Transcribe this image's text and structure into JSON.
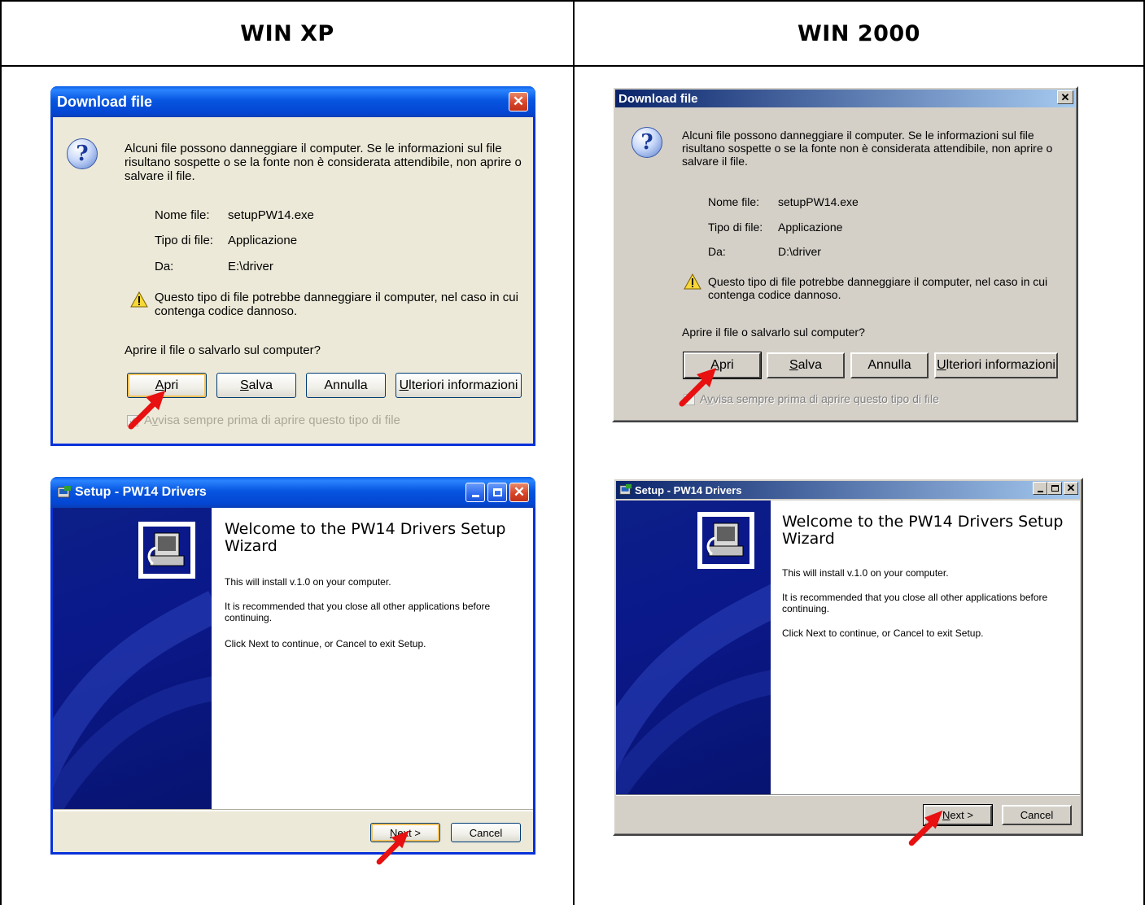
{
  "columns": {
    "left": "WIN XP",
    "right": "WIN 2000"
  },
  "download": {
    "title": "Download file",
    "message": "Alcuni file possono danneggiare il computer. Se le informazioni sul file risultano sospette o se la fonte non è considerata attendibile, non aprire o salvare il file.",
    "name_label": "Nome file:",
    "name_value": "setupPW14.exe",
    "type_label": "Tipo di file:",
    "type_value": "Applicazione",
    "from_label": "Da:",
    "from_value_xp": "E:\\driver",
    "from_value_2k": "D:\\driver",
    "warning": "Questo tipo di file potrebbe danneggiare il computer, nel caso in cui contenga codice dannoso.",
    "question": "Aprire il file o salvarlo sul computer?",
    "btn_open_pre": "A",
    "btn_open_rest": "pri",
    "btn_save_pre": "S",
    "btn_save_rest": "alva",
    "btn_cancel": "Annulla",
    "btn_more_pre": "U",
    "btn_more_rest": "lteriori informazioni",
    "checkbox_pre": "A",
    "checkbox_u": "v",
    "checkbox_rest": "visa sempre prima di aprire questo tipo di file",
    "checkbox_checked": true
  },
  "wizard": {
    "title": "Setup - PW14 Drivers",
    "heading": "Welcome to the PW14 Drivers Setup Wizard",
    "line1": "This will install v.1.0 on your computer.",
    "line2": "It is recommended that you close all other applications before continuing.",
    "line3": "Click Next to continue, or Cancel to exit Setup.",
    "btn_next_pre": "N",
    "btn_next_rest": "ext >",
    "btn_cancel": "Cancel"
  },
  "icons": [
    "question-icon",
    "warning-icon",
    "close-icon",
    "minimize-icon",
    "maximize-icon",
    "setup-icon",
    "arrow-pointer-icon"
  ],
  "colors": {
    "xp_title": "#0346d4",
    "xp_face": "#ece9d8",
    "w2k_title_start": "#0a246a",
    "w2k_title_end": "#a6caf0",
    "w2k_face": "#d4d0c8",
    "wizard_side": "#0a188a",
    "arrow": "#e81010"
  }
}
